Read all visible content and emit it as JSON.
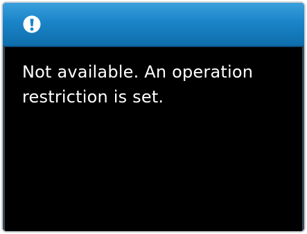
{
  "dialog": {
    "icon": "exclamation-alert-icon",
    "message": "Not available. An operation\nrestriction is set."
  },
  "colors": {
    "title_bar": "#1a84c8",
    "screen_background": "#000000",
    "text": "#ffffff"
  }
}
